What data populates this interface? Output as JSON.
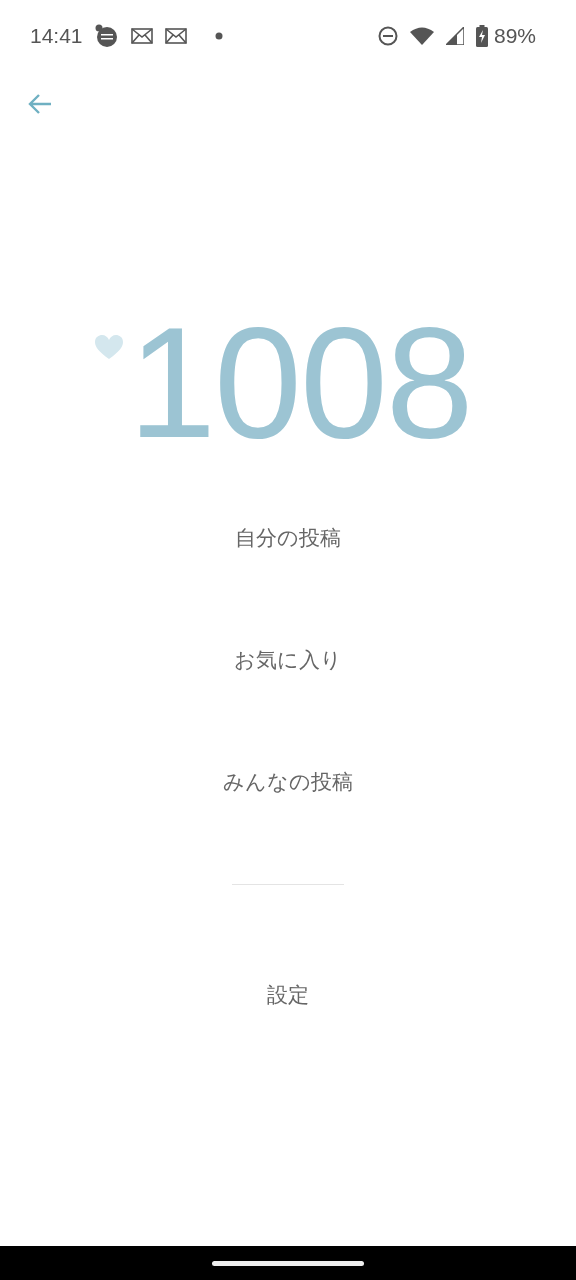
{
  "status_bar": {
    "time": "14:41",
    "battery": "89%"
  },
  "counter": {
    "value": "1008"
  },
  "menu": {
    "items": [
      {
        "label": "自分の投稿"
      },
      {
        "label": "お気に入り"
      },
      {
        "label": "みんなの投稿"
      }
    ]
  },
  "settings": {
    "label": "設定"
  }
}
